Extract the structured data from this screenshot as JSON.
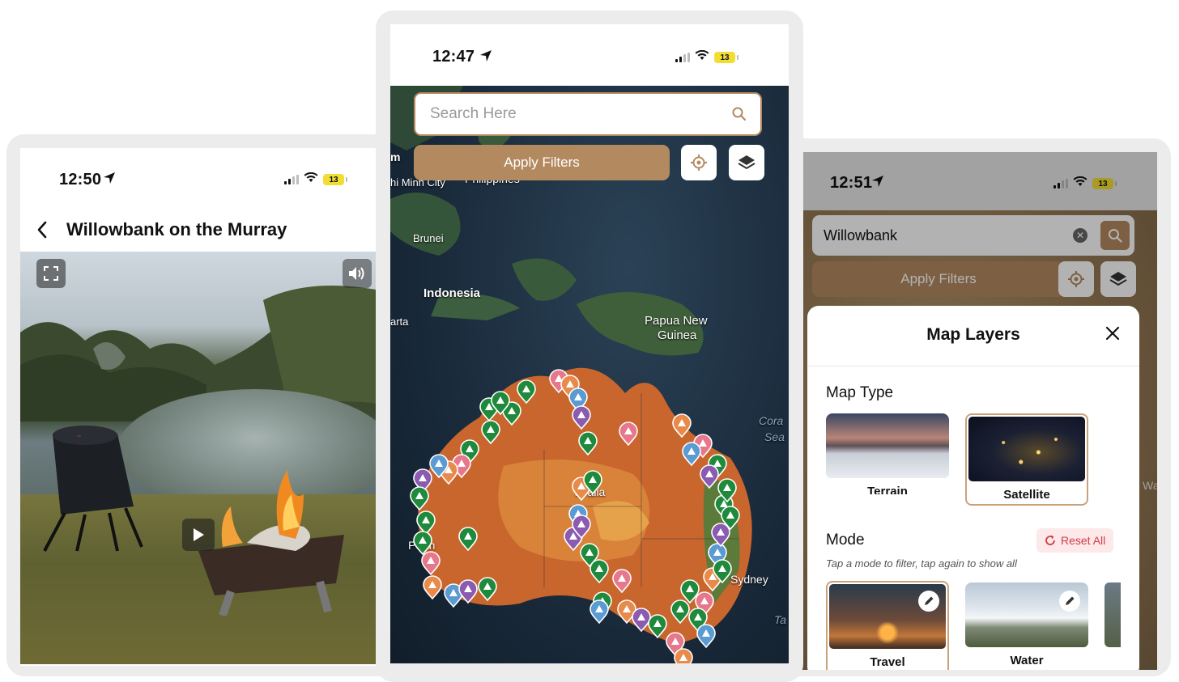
{
  "left_phone": {
    "status": {
      "time": "12:50",
      "battery": "13"
    },
    "header": {
      "title": "Willowbank on the Murray"
    }
  },
  "middle_phone": {
    "status": {
      "time": "12:47",
      "battery": "13"
    },
    "search": {
      "placeholder": "Search Here"
    },
    "apply_filters_label": "Apply Filters",
    "map_labels": [
      "m",
      "hi Minh City",
      "Philippines",
      "Brunei",
      "Indonesia",
      "arta",
      "Papua New",
      "Guinea",
      "Cora",
      "Sea",
      "stralia",
      "Perth",
      "Sydney",
      "Ta"
    ]
  },
  "right_phone": {
    "status": {
      "time": "12:51",
      "battery": "13"
    },
    "search": {
      "value": "Willowbank"
    },
    "apply_filters_label": "Apply Filters",
    "edge_label": "Wa",
    "layers_sheet": {
      "title": "Map Layers",
      "map_type_title": "Map Type",
      "map_types": [
        {
          "label": "Terrain",
          "selected": false
        },
        {
          "label": "Satellite",
          "selected": true
        }
      ],
      "mode_title": "Mode",
      "reset_label": "Reset All",
      "hint": "Tap a mode to filter, tap again to show all",
      "modes": [
        {
          "label": "Travel"
        },
        {
          "label": "Water"
        }
      ]
    }
  },
  "colors": {
    "accent": "#b38a60",
    "reset_red": "#d33a45",
    "pin_green": "#1f8a3c",
    "pin_pink": "#e7778a",
    "pin_orange": "#e88a4a",
    "pin_blue": "#5a9bd4",
    "pin_purple": "#8a5bb0"
  }
}
